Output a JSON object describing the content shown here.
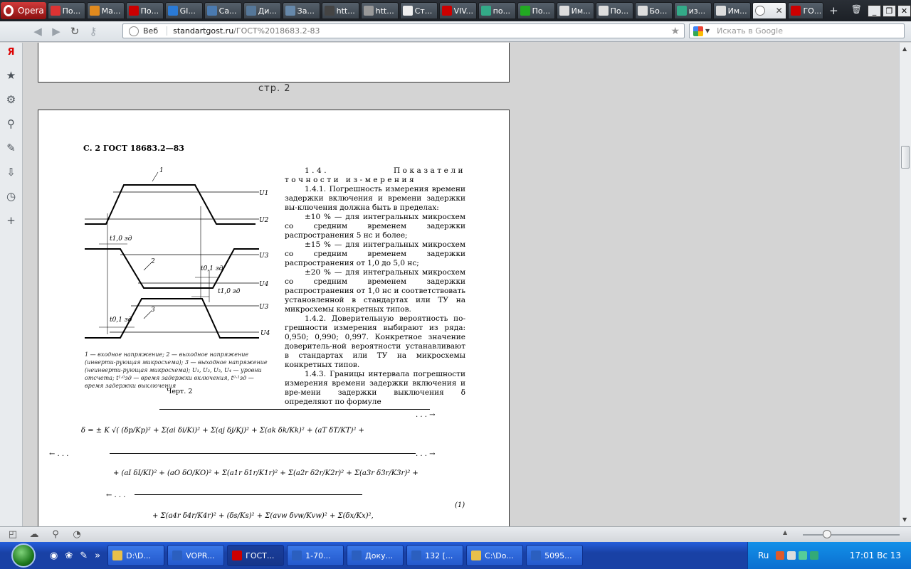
{
  "browser": {
    "menu_label": "Opera",
    "tabs": [
      {
        "label": "По...",
        "color": "#d33"
      },
      {
        "label": "Ма...",
        "color": "#e08a1e"
      },
      {
        "label": "По...",
        "color": "#c00"
      },
      {
        "label": "GI...",
        "color": "#2a7ad6"
      },
      {
        "label": "Са...",
        "color": "#4a7ab0"
      },
      {
        "label": "Ди...",
        "color": "#557799"
      },
      {
        "label": "За...",
        "color": "#6688aa"
      },
      {
        "label": "htt...",
        "color": "#444"
      },
      {
        "label": "htt...",
        "color": "#999"
      },
      {
        "label": "Ст...",
        "color": "#eee"
      },
      {
        "label": "VIV...",
        "color": "#c00"
      },
      {
        "label": "по...",
        "color": "#3a8"
      },
      {
        "label": "По...",
        "color": "#2a2"
      },
      {
        "label": "Им...",
        "color": "#ddd"
      },
      {
        "label": "По...",
        "color": "#ddd"
      },
      {
        "label": "Бо...",
        "color": "#ddd"
      },
      {
        "label": "из...",
        "color": "#3a8"
      },
      {
        "label": "Им...",
        "color": "#ddd"
      }
    ],
    "active_tab_close": "✕",
    "last_tab": {
      "label": "ГО...",
      "color": "#c00"
    },
    "add_tab": "+",
    "trash": "🗑",
    "win_min": "_",
    "win_max": "❐",
    "win_close": "✕"
  },
  "addressbar": {
    "back": "◀",
    "forward": "▶",
    "reload": "↻",
    "key": "⚷",
    "scheme_label": "Веб",
    "host": "standartgost.ru",
    "path": "/ГОСТ%2018683.2-83",
    "bookmark_star": "★",
    "search_placeholder": "Искать в Google",
    "search_dropdown": "▼"
  },
  "sidepanel": {
    "items": [
      {
        "name": "yandex-icon",
        "glyph": "Я"
      },
      {
        "name": "bookmarks-icon",
        "glyph": "★"
      },
      {
        "name": "settings-icon",
        "glyph": "⚙"
      },
      {
        "name": "unite-icon",
        "glyph": "⚲"
      },
      {
        "name": "notes-icon",
        "glyph": "✎"
      },
      {
        "name": "downloads-icon",
        "glyph": "⇩"
      },
      {
        "name": "history-icon",
        "glyph": "◷"
      },
      {
        "name": "add-panel-icon",
        "glyph": "+"
      }
    ]
  },
  "document": {
    "page_label": "стр. 2",
    "header": "С. 2 ГОСТ 18683.2—83",
    "paragraphs": [
      {
        "text": "1.4. Показатели точности из-мерения",
        "spaced": true
      },
      {
        "text": "1.4.1. Погрешность измерения времени задержки включения и времени задержки вы-ключения должна быть в пределах:",
        "spaced": false
      },
      {
        "text": "±10 % — для интегральных микросхем со средним временем задержки распространения 5 нс и более;",
        "spaced": false
      },
      {
        "text": "±15 % — для интегральных микросхем со средним временем задержки распространения от 1,0 до 5,0 нс;",
        "spaced": false
      },
      {
        "text": "±20 % — для интегральных микросхем со средним временем задержки распространения от 1,0 нс и соответствовать установленной в стандартах или ТУ на микросхемы конкретных типов.",
        "spaced": false
      },
      {
        "text": "1.4.2. Доверительную вероятность по-грешности измерения выбирают из ряда: 0,950; 0,990; 0,997. Конкретное значение доверитель-ной вероятности устанавливают в стандартах или ТУ на микросхемы конкретных типов.",
        "spaced": false
      },
      {
        "text": "1.4.3. Границы интервала погрешности измерения времени задержки включения и вре-мени задержки выключения δ определяют по формуле",
        "spaced": false
      }
    ],
    "caption": "1 — входное напряжение; 2 — выходное напряжение (инверти-рующая микросхема); 3 — выходное напряжение (неинверти-рующая микросхема); U₁, U₂, U₃, U₄ — уровни отсчета; t¹·⁰зд — время задержки включения, t⁰·¹зд — время задержки выключения",
    "figure_label": "Черт. 2",
    "diagram_labels": {
      "curve1": "1",
      "curve2": "2",
      "curve3": "3",
      "u1": "U1",
      "u2": "U2",
      "u3a": "U3",
      "u4a": "U4",
      "u3b": "U3",
      "u4b": "U4",
      "t10a": "t1,0 зд",
      "t01a": "t0,1 зд",
      "t10b": "t1,0 зд",
      "t01b": "t0,1 зд"
    },
    "formula": {
      "line1": "δ = ± K √( (δp/Kp)² + Σ(ai δi/Ki)² + Σ(aj δj/Kj)² + Σ(ak δk/Kk)² + (aT δT/KT)² +",
      "cont1": ". . . →",
      "line2a": "← . . .",
      "cont2": ". . . →",
      "line3": "+ (aI δI/KI)² + (aO δO/KO)² + Σ(a1r δ1r/K1r)² + Σ(a2r δ2r/K2r)² + Σ(a3r δ3r/K3r)² +",
      "line4a": "← . . .",
      "line5": "+ Σ(a4r δ4r/K4r)² + (δs/Ks)² + Σ(avw δvw/Kvw)² + Σ(δx/Kx)²,",
      "eq_number": "(1)"
    }
  },
  "statusbar": {
    "items": [
      "◰",
      "☁",
      "⚲",
      "◔"
    ],
    "zoom_up": "▲",
    "zoom_level": 0.25
  },
  "taskbar": {
    "quicklaunch": [
      "◉",
      "❀",
      "✎",
      "»"
    ],
    "tasks": [
      {
        "label": "D:\\D...",
        "color": "#e8c04a",
        "active": false
      },
      {
        "label": "VOPR...",
        "color": "#2b5fbf",
        "active": false
      },
      {
        "label": "ГОСТ...",
        "color": "#c00",
        "active": true
      },
      {
        "label": "1-70...",
        "color": "#2b5fbf",
        "active": false
      },
      {
        "label": "Доку...",
        "color": "#2b5fbf",
        "active": false
      },
      {
        "label": "132 [...",
        "color": "#2b5fbf",
        "active": false
      },
      {
        "label": "C:\\Do...",
        "color": "#e8c04a",
        "active": false
      },
      {
        "label": "5095...",
        "color": "#2b5fbf",
        "active": false
      }
    ],
    "tray_label": "Ru",
    "clock": "17:01 Вс 13"
  }
}
